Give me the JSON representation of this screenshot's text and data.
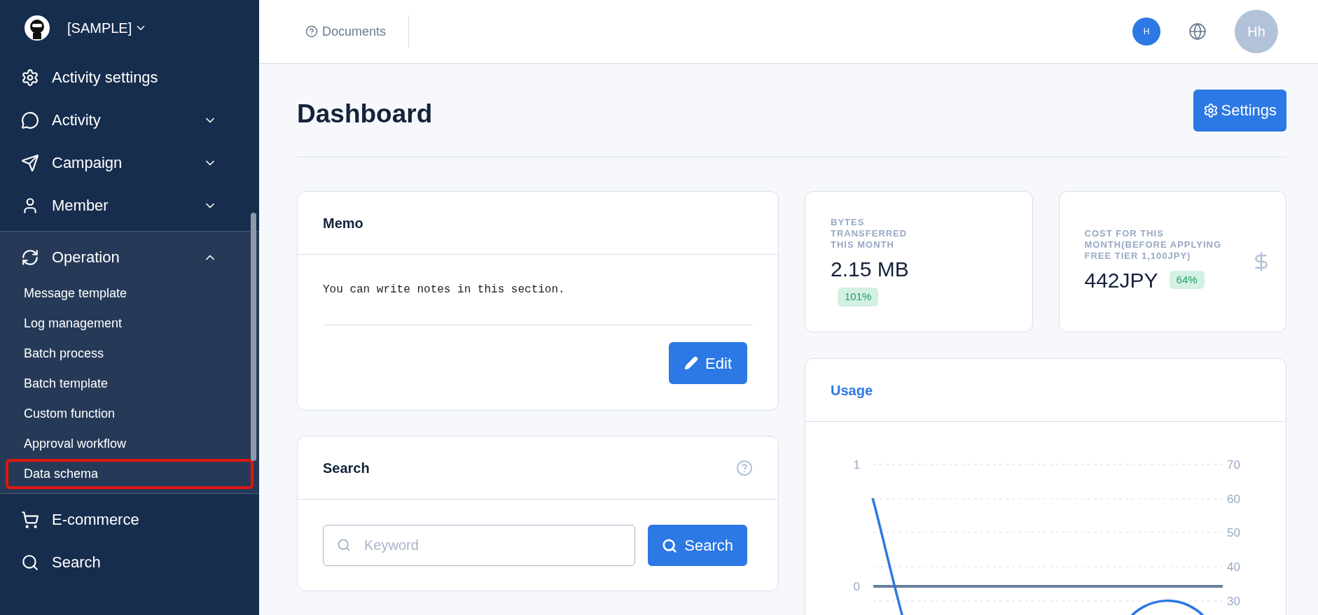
{
  "sidebar": {
    "brand": "[SAMPLE]",
    "items": [
      {
        "kind": "link",
        "label": "Activity settings"
      },
      {
        "kind": "group",
        "label": "Activity",
        "expanded": false
      },
      {
        "kind": "group",
        "label": "Campaign",
        "expanded": false
      },
      {
        "kind": "group",
        "label": "Member",
        "expanded": false
      },
      {
        "kind": "group",
        "label": "Operation",
        "expanded": true,
        "children": [
          {
            "label": "Message template",
            "highlighted": false
          },
          {
            "label": "Log management",
            "highlighted": false
          },
          {
            "label": "Batch process",
            "highlighted": false
          },
          {
            "label": "Batch template",
            "highlighted": false
          },
          {
            "label": "Custom function",
            "highlighted": false
          },
          {
            "label": "Approval workflow",
            "highlighted": false
          },
          {
            "label": "Data schema",
            "highlighted": true
          }
        ]
      },
      {
        "kind": "link",
        "label": "E-commerce"
      },
      {
        "kind": "link",
        "label": "Search"
      }
    ]
  },
  "topbar": {
    "documents": "Documents",
    "badge": "H",
    "avatar": "Hh"
  },
  "page": {
    "title": "Dashboard",
    "settings_button": "Settings"
  },
  "memo": {
    "title": "Memo",
    "text": "You can write notes in this section.",
    "edit_button": "Edit"
  },
  "search": {
    "title": "Search",
    "placeholder": "Keyword",
    "button": "Search"
  },
  "stats": [
    {
      "label": "BYTES\nTRANSFERRED\nTHIS MONTH",
      "value": "2.15 MB",
      "badge": "101%"
    },
    {
      "label": "COST FOR THIS\nMONTH(BEFORE APPLYING\nFREE TIER 1,100JPY)",
      "value": "442JPY",
      "badge": "64%"
    }
  ],
  "usage": {
    "title": "Usage",
    "left_ticks": [
      "1",
      "0"
    ],
    "right_ticks": [
      "70",
      "60",
      "50",
      "40",
      "30"
    ]
  }
}
